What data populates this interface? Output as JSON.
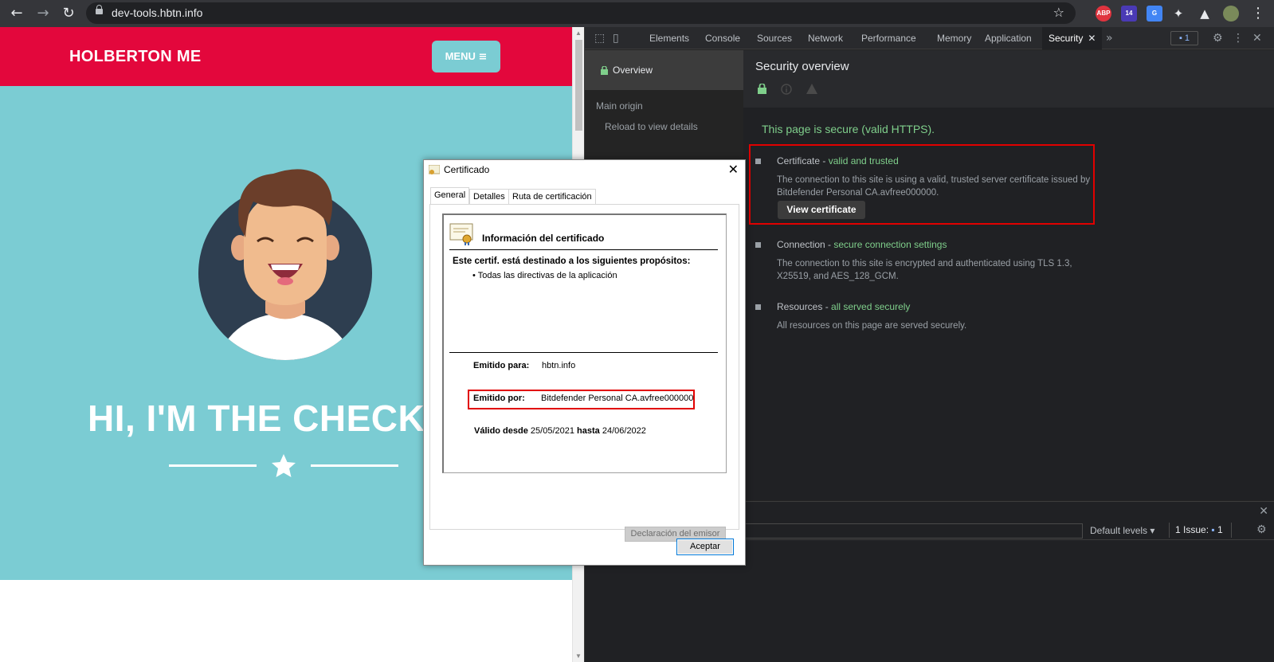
{
  "browser": {
    "url": "dev-tools.hbtn.info",
    "extensions": [
      "ABP",
      "14"
    ]
  },
  "site": {
    "brand": "HOLBERTON ME",
    "menu_label": "MENU",
    "hero_title": "HI, I'M THE CHECK",
    "header_color": "#e3073c",
    "hero_color": "#7bccd3"
  },
  "devtools": {
    "tabs": [
      "Elements",
      "Console",
      "Sources",
      "Network",
      "Performance",
      "Memory",
      "Application",
      "Security"
    ],
    "active_tab": "Security",
    "issues_count": "1",
    "sidebar": {
      "overview": "Overview",
      "main_origin": "Main origin",
      "reload": "Reload to view details"
    },
    "security": {
      "title": "Security overview",
      "secure_message": "This page is secure (valid HTTPS).",
      "certificate": {
        "label": "Certificate - ",
        "status": "valid and trusted",
        "desc": "The connection to this site is using a valid, trusted server certificate issued by Bitdefender Personal CA.avfree000000.",
        "button": "View certificate"
      },
      "connection": {
        "label": "Connection - ",
        "status": "secure connection settings",
        "desc": "The connection to this site is encrypted and authenticated using TLS 1.3, X25519, and AES_128_GCM."
      },
      "resources": {
        "label": "Resources - ",
        "status": "all served securely",
        "desc": "All resources on this page are served securely."
      }
    },
    "drawer": {
      "levels": "Default levels ▾",
      "issue_label": "1 Issue:",
      "issue_count": "1"
    }
  },
  "certificate_dialog": {
    "title": "Certificado",
    "tabs": [
      "General",
      "Detalles",
      "Ruta de certificación"
    ],
    "info_title": "Información del certificado",
    "purposes_title": "Este certif. está destinado a los siguientes propósitos:",
    "purpose_item": "• Todas las directivas de la aplicación",
    "issued_to_label": "Emitido para:",
    "issued_to": "hbtn.info",
    "issued_by_label": "Emitido por:",
    "issued_by": "Bitdefender Personal CA.avfree000000",
    "valid_from_label": "Válido desde",
    "valid_from": "25/05/2021",
    "valid_to_label": "hasta",
    "valid_to": "24/06/2022",
    "issuer_statement": "Declaración del emisor",
    "accept": "Aceptar"
  }
}
